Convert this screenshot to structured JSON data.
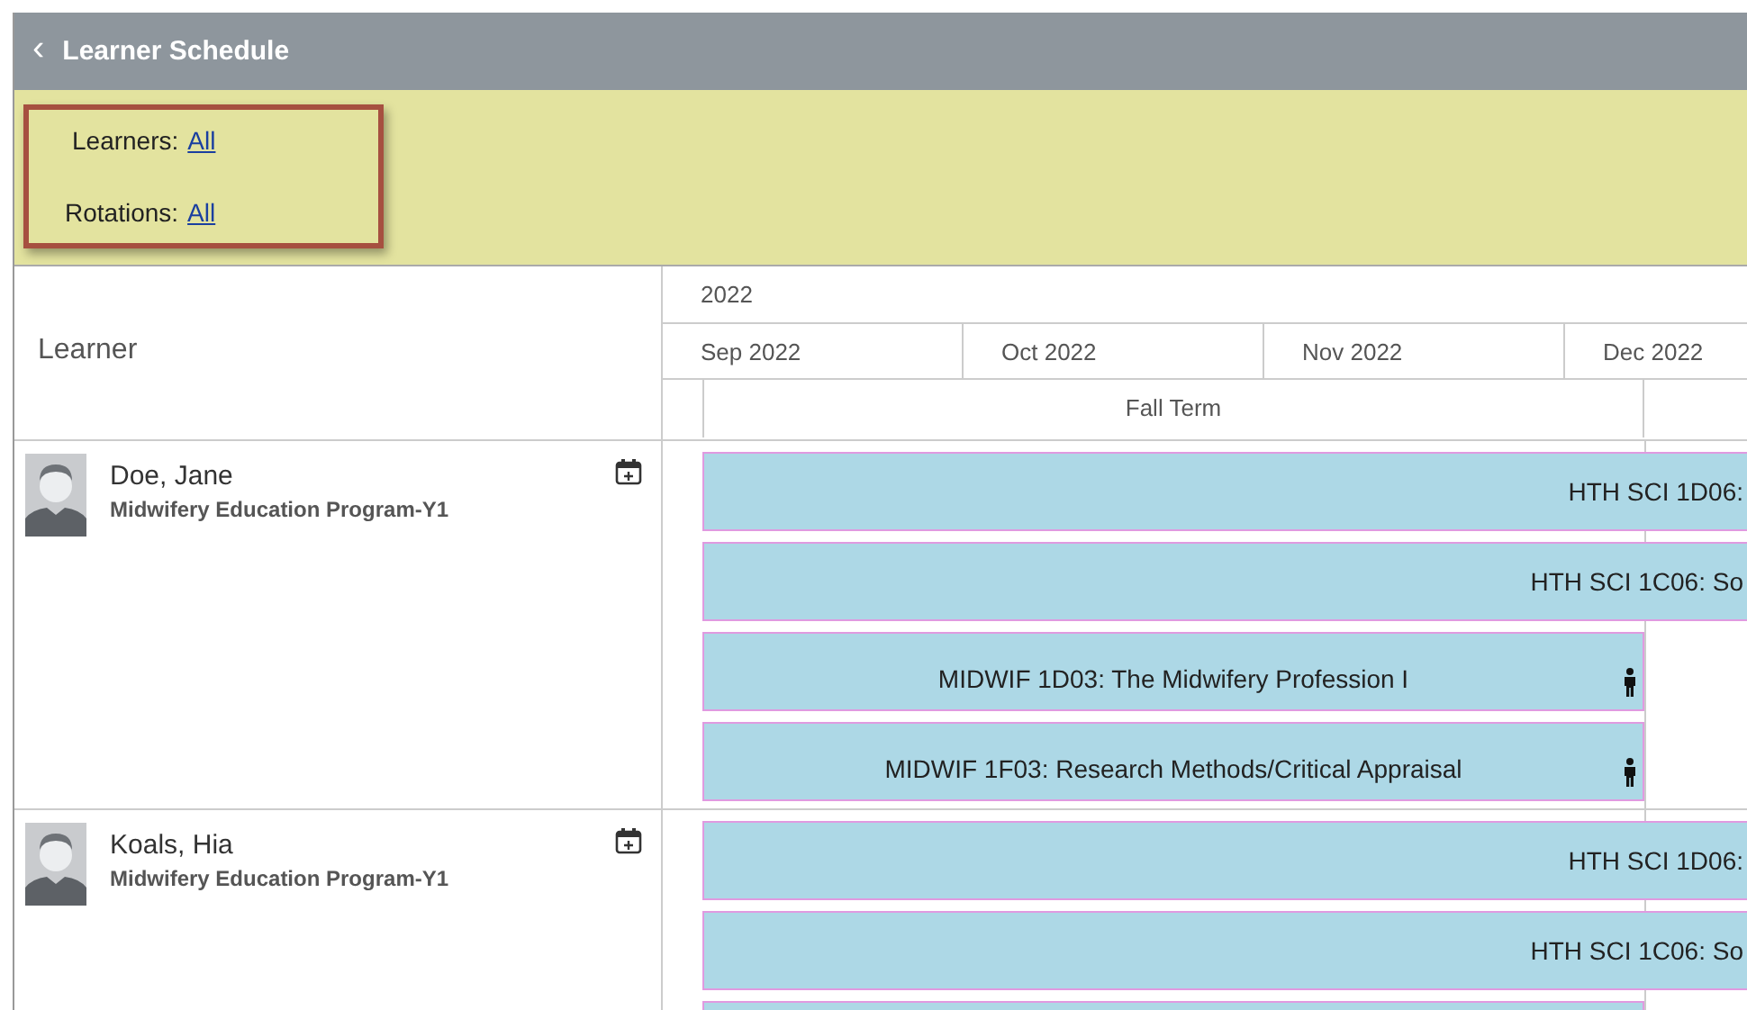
{
  "header": {
    "back": "‹",
    "title": "Learner Schedule"
  },
  "filters": [
    {
      "label": "Learners:",
      "value": "All"
    },
    {
      "label": "Rotations:",
      "value": "All"
    }
  ],
  "grid": {
    "learner_column": "Learner",
    "year": "2022",
    "months": [
      "Sep 2022",
      "Oct 2022",
      "Nov 2022",
      "Dec 2022"
    ],
    "term": "Fall Term"
  },
  "learners": [
    {
      "name": "Doe, Jane",
      "program": "Midwifery Education Program-Y1",
      "bars": [
        {
          "kind": "full",
          "label": "HTH SCI 1D06:"
        },
        {
          "kind": "full",
          "label": "HTH SCI 1C06: So"
        },
        {
          "kind": "term",
          "label": "MIDWIF 1D03: The Midwifery Profession I"
        },
        {
          "kind": "term",
          "label": "MIDWIF 1F03: Research Methods/Critical Appraisal"
        }
      ]
    },
    {
      "name": "Koals, Hia",
      "program": "Midwifery Education Program-Y1",
      "bars": [
        {
          "kind": "full",
          "label": "HTH SCI 1D06:"
        },
        {
          "kind": "full",
          "label": "HTH SCI 1C06: So"
        },
        {
          "kind": "term"
        }
      ]
    }
  ]
}
